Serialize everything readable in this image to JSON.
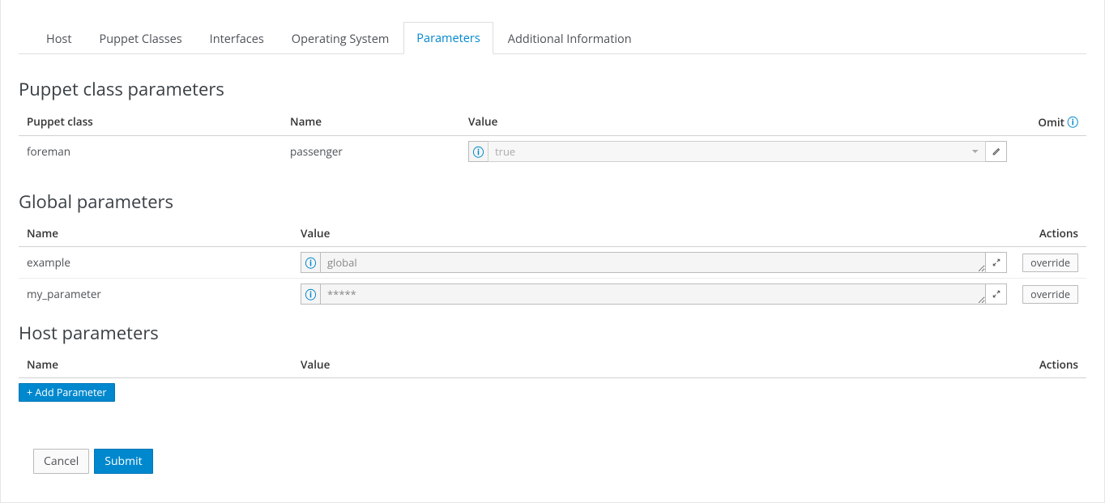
{
  "tabs": [
    {
      "label": "Host"
    },
    {
      "label": "Puppet Classes"
    },
    {
      "label": "Interfaces"
    },
    {
      "label": "Operating System"
    },
    {
      "label": "Parameters",
      "active": true
    },
    {
      "label": "Additional Information"
    }
  ],
  "sections": {
    "puppet_class": {
      "title": "Puppet class parameters",
      "headers": {
        "class": "Puppet class",
        "name": "Name",
        "value": "Value",
        "omit": "Omit"
      },
      "rows": [
        {
          "class": "foreman",
          "name": "passenger",
          "value": "true"
        }
      ]
    },
    "global": {
      "title": "Global parameters",
      "headers": {
        "name": "Name",
        "value": "Value",
        "actions": "Actions"
      },
      "rows": [
        {
          "name": "example",
          "value": "global",
          "action": "override"
        },
        {
          "name": "my_parameter",
          "value": "*****",
          "action": "override"
        }
      ]
    },
    "host": {
      "title": "Host parameters",
      "headers": {
        "name": "Name",
        "value": "Value",
        "actions": "Actions"
      },
      "add_label": "+ Add Parameter"
    }
  },
  "form": {
    "cancel": "Cancel",
    "submit": "Submit"
  }
}
